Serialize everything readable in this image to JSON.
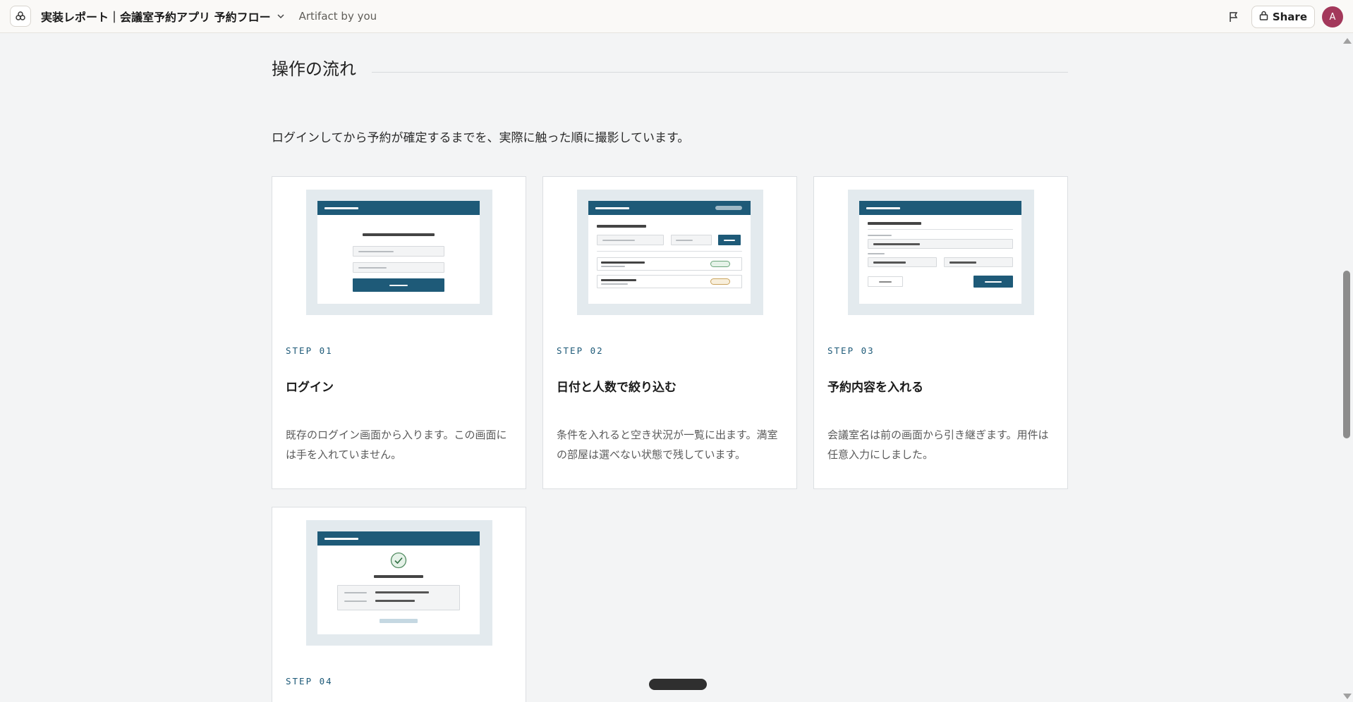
{
  "topbar": {
    "title": "実装レポート｜会議室予約アプリ 予約フロー",
    "subtitle": "Artifact by you",
    "share_label": "Share",
    "avatar_initial": "A"
  },
  "section": {
    "heading": "操作の流れ",
    "intro": "ログインしてから予約が確定するまでを、実際に触った順に撮影しています。"
  },
  "steps": [
    {
      "step": "STEP 01",
      "title": "ログイン",
      "desc": "既存のログイン画面から入ります。この画面には手を入れていません。"
    },
    {
      "step": "STEP 02",
      "title": "日付と人数で絞り込む",
      "desc": "条件を入れると空き状況が一覧に出ます。満室の部屋は選べない状態で残しています。"
    },
    {
      "step": "STEP 03",
      "title": "予約内容を入れる",
      "desc": "会議室名は前の画面から引き継ぎます。用件は任意入力にしました。"
    },
    {
      "step": "STEP 04",
      "title": "",
      "desc": ""
    }
  ],
  "colors": {
    "accent": "#1e5a78",
    "avatar": "#a3385b",
    "available": "#6aa57a",
    "limited": "#c9a25c"
  },
  "icons": [
    "app-icon",
    "chevron-down-icon",
    "flag-icon",
    "lock-icon",
    "check-circle-icon"
  ]
}
